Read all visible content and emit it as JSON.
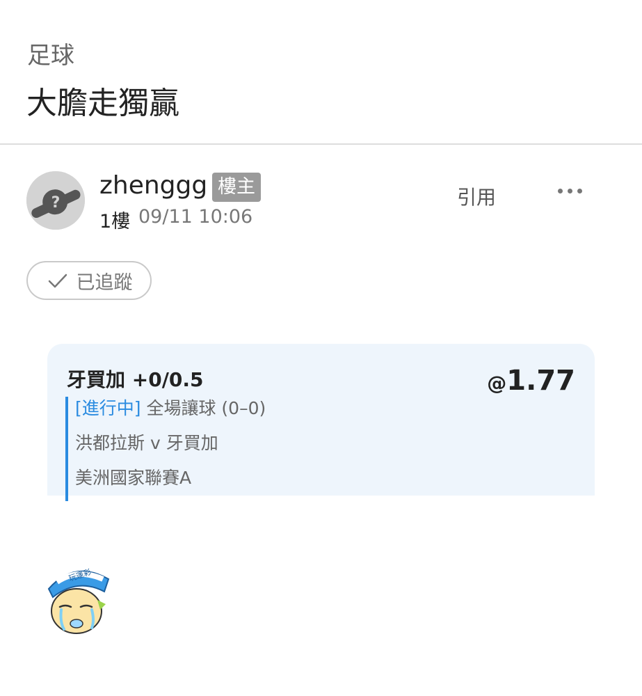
{
  "header": {
    "category": "足球",
    "title": "大膽走獨贏"
  },
  "post": {
    "username": "zhenggg",
    "badge": "樓主",
    "floor": "1樓",
    "timestamp": "09/11 10:06",
    "quote_label": "引用",
    "more_icon": "more-horizontal-icon",
    "follow_label": "已追蹤",
    "follow_icon": "check-icon"
  },
  "bet": {
    "selection": "牙買加 +0/0.5",
    "odds_prefix": "@",
    "odds": "1.77",
    "status": "[進行中]",
    "market": "全場讓球 (0–0)",
    "match": "洪都拉斯 v 牙買加",
    "league": "美洲國家聯賽A"
  },
  "sticker": {
    "cap_text": "玩運彩"
  },
  "colors": {
    "accent": "#2a8be0",
    "card_bg": "#eef5fc",
    "badge_bg": "#9a9a9a"
  }
}
